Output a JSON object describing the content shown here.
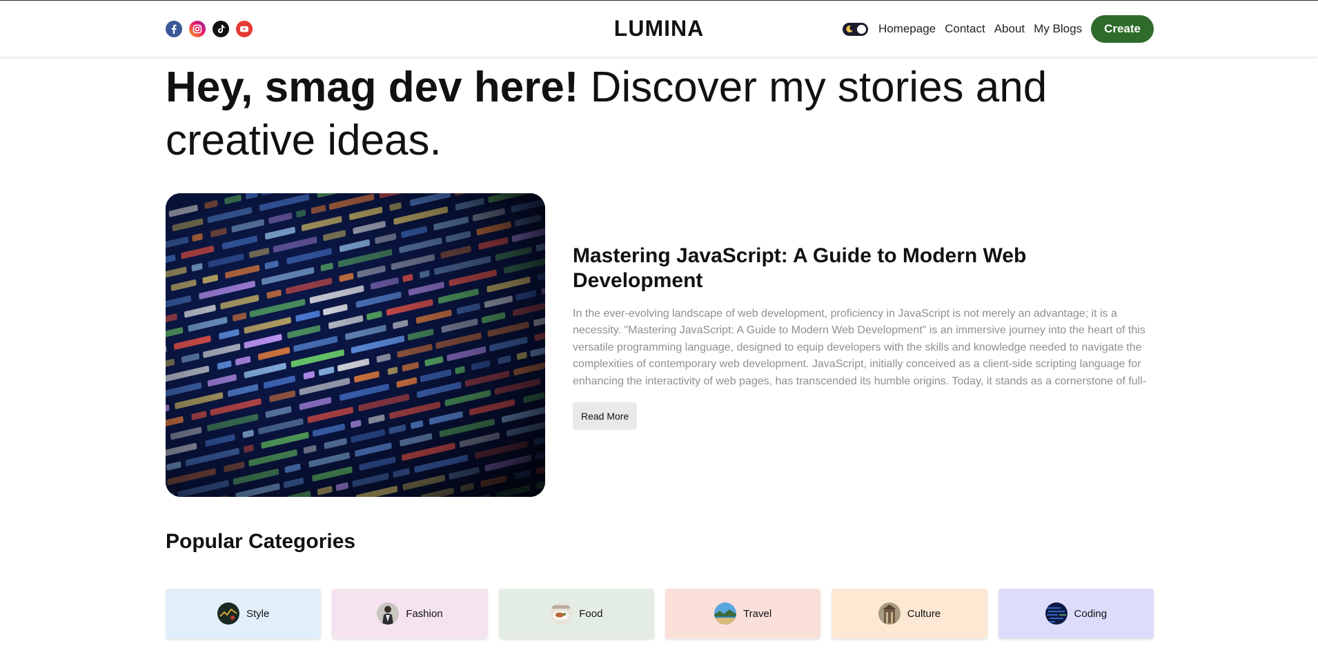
{
  "header": {
    "logo": "LUMINA",
    "socials": [
      {
        "name": "facebook",
        "icon": "facebook-icon",
        "color": "#3b5998"
      },
      {
        "name": "instagram",
        "icon": "instagram-icon",
        "color": "#e91e63"
      },
      {
        "name": "tiktok",
        "icon": "tiktok-icon",
        "color": "#111111"
      },
      {
        "name": "youtube",
        "icon": "youtube-icon",
        "color": "#e53935"
      }
    ],
    "theme_toggle_icon": "moon-icon",
    "nav": {
      "homepage": "Homepage",
      "contact": "Contact",
      "about": "About",
      "my_blogs": "My Blogs"
    },
    "create_label": "Create",
    "create_color": "#2f6b2a"
  },
  "hero": {
    "bold": "Hey, smag dev here!",
    "rest": " Discover my stories and creative ideas."
  },
  "featured": {
    "image_icon": "code-screen-image",
    "title": "Mastering JavaScript: A Guide to Modern Web Development",
    "excerpt": "In the ever-evolving landscape of web development, proficiency in JavaScript is not merely an advantage; it is a necessity. \"Mastering JavaScript: A Guide to Modern Web Development\" is an immersive journey into the heart of this versatile programming language, designed to equip developers with the skills and knowledge needed to navigate the complexities of contemporary web development. JavaScript, initially conceived as a client-side scripting language for enhancing the interactivity of web pages, has transcended its humble origins. Today, it stands as a cornerstone of full-stack development, powering both the client and server sid...",
    "read_more": "Read More"
  },
  "categories": {
    "title": "Popular Categories",
    "items": [
      {
        "label": "Style",
        "bg": "#e1effb"
      },
      {
        "label": "Fashion",
        "bg": "#f5e4ef"
      },
      {
        "label": "Food",
        "bg": "#e4ede4"
      },
      {
        "label": "Travel",
        "bg": "#fbe0da"
      },
      {
        "label": "Culture",
        "bg": "#fce8d3"
      },
      {
        "label": "Coding",
        "bg": "#dddcfb"
      }
    ]
  }
}
